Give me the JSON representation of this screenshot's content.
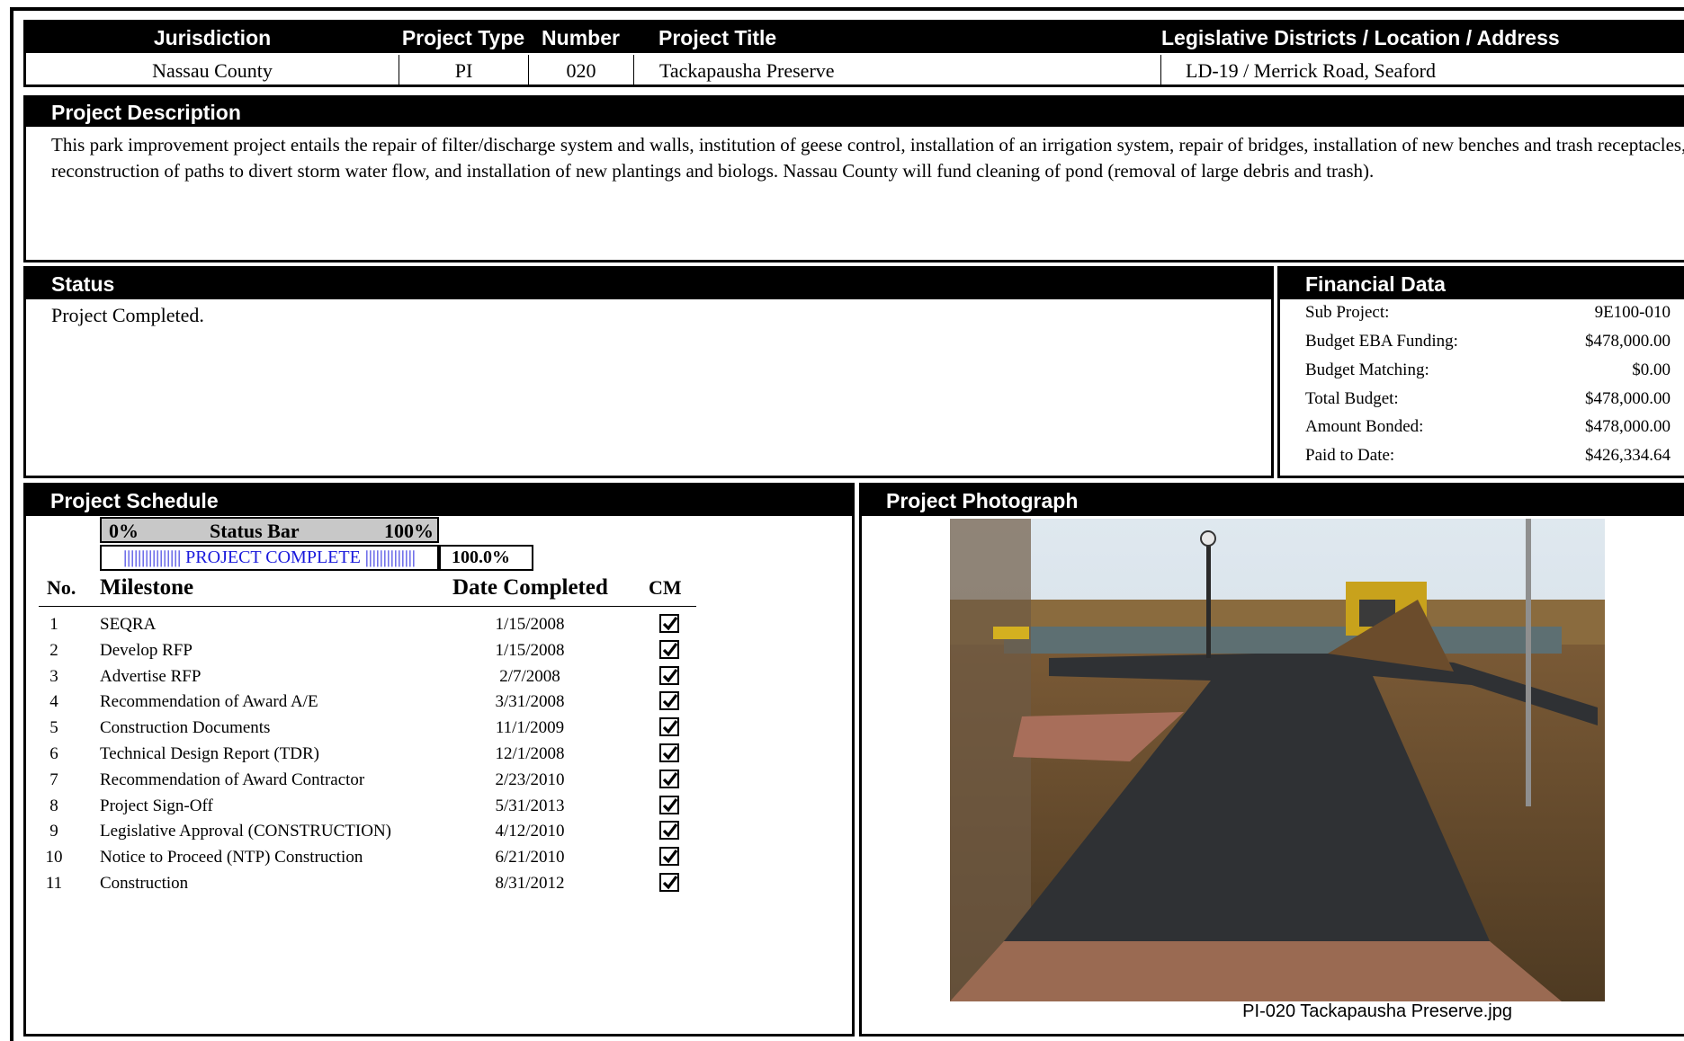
{
  "info": {
    "headers": [
      "Jurisdiction",
      "Project Type",
      "Number",
      "Project Title",
      "Legislative Districts / Location / Address"
    ],
    "values": [
      "Nassau County",
      "PI",
      "020",
      "Tackapausha Preserve",
      "LD-19 / Merrick Road, Seaford"
    ]
  },
  "description": {
    "title": "Project Description",
    "text": "This park improvement project entails the repair of filter/discharge system and walls, institution of geese control, installation of an irrigation system, repair of bridges, installation of new benches and trash receptacles, reconstruction of paths to divert storm water flow, and installation of new plantings and biologs.  Nassau County will fund cleaning of pond (removal of large debris and trash)."
  },
  "status": {
    "title": "Status",
    "text": "Project Completed."
  },
  "financial": {
    "title": "Financial Data",
    "rows": [
      {
        "label": "Sub Project:",
        "value": "9E100-010"
      },
      {
        "label": "Budget EBA Funding:",
        "value": "$478,000.00"
      },
      {
        "label": "Budget Matching:",
        "value": "$0.00"
      },
      {
        "label": "Total Budget:",
        "value": "$478,000.00"
      },
      {
        "label": "Amount Bonded:",
        "value": "$478,000.00"
      },
      {
        "label": "Paid to Date:",
        "value": "$426,334.64"
      }
    ]
  },
  "schedule": {
    "title": "Project Schedule",
    "status_bar": {
      "min_label": "0%",
      "title": "Status Bar",
      "max_label": "100%",
      "bar_text": "|||||||||||||||| PROJECT COMPLETE ||||||||||||||",
      "percent": "100.0%",
      "progress_fraction": 1.0
    },
    "columns": {
      "no": "No.",
      "milestone": "Milestone",
      "date": "Date Completed",
      "cm": "CM"
    },
    "milestones": [
      {
        "no": "1",
        "name": "SEQRA",
        "date": "1/15/2008",
        "cm": true
      },
      {
        "no": "2",
        "name": "Develop RFP",
        "date": "1/15/2008",
        "cm": true
      },
      {
        "no": "3",
        "name": "Advertise RFP",
        "date": "2/7/2008",
        "cm": true
      },
      {
        "no": "4",
        "name": "Recommendation of Award A/E",
        "date": "3/31/2008",
        "cm": true
      },
      {
        "no": "5",
        "name": "Construction Documents",
        "date": "11/1/2009",
        "cm": true
      },
      {
        "no": "6",
        "name": "Technical Design Report (TDR)",
        "date": "12/1/2008",
        "cm": true
      },
      {
        "no": "7",
        "name": "Recommendation of Award Contractor",
        "date": "2/23/2010",
        "cm": true
      },
      {
        "no": "8",
        "name": "Project Sign-Off",
        "date": "5/31/2013",
        "cm": true
      },
      {
        "no": "9",
        "name": "Legislative Approval (CONSTRUCTION)",
        "date": "4/12/2010",
        "cm": true
      },
      {
        "no": "10",
        "name": "Notice to Proceed (NTP) Construction",
        "date": "6/21/2010",
        "cm": true
      },
      {
        "no": "11",
        "name": "Construction",
        "date": "8/31/2012",
        "cm": true
      }
    ]
  },
  "photo": {
    "title": "Project Photograph",
    "caption": "PI-020 Tackapausha Preserve.jpg"
  }
}
